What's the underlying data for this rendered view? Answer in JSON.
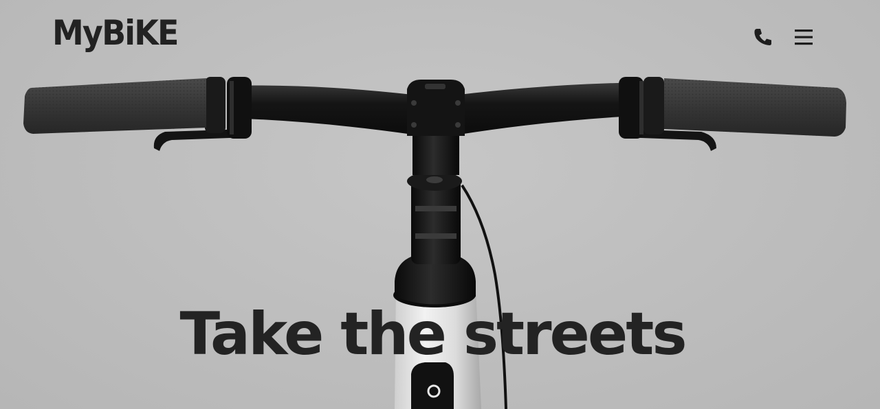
{
  "brand": {
    "logo_text": "MyBiKE"
  },
  "header": {
    "phone_icon": "phone-icon",
    "menu_icon": "hamburger-menu-icon"
  },
  "hero": {
    "headline": "Take the streets",
    "image": "bicycle-handlebar-photo",
    "background_color": "#bebebe",
    "text_color": "#232323"
  }
}
